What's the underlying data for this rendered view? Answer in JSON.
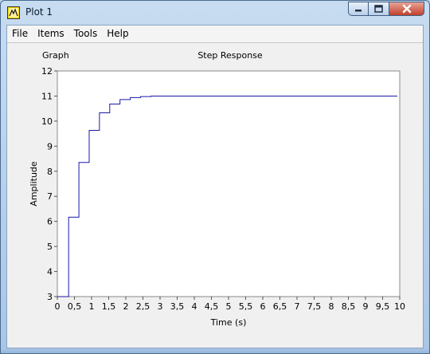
{
  "window": {
    "title": "Plot 1",
    "app_icon": "labview-icon",
    "controls": [
      "minimize-icon",
      "maximize-icon",
      "close-icon"
    ]
  },
  "menu": [
    "File",
    "Items",
    "Tools",
    "Help"
  ],
  "graph_label": "Graph",
  "chart_data": {
    "type": "line",
    "title": "Step Response",
    "xlabel": "Time (s)",
    "ylabel": "Amplitude",
    "xlim": [
      0,
      10
    ],
    "ylim": [
      3,
      12
    ],
    "x_ticks": [
      "0",
      "0,5",
      "1",
      "1,5",
      "2",
      "2,5",
      "3",
      "3,5",
      "4",
      "4,5",
      "5",
      "5,5",
      "6",
      "6,5",
      "7",
      "7,5",
      "8",
      "8,5",
      "9",
      "9,5",
      "10"
    ],
    "y_ticks": [
      "3",
      "4",
      "5",
      "6",
      "7",
      "8",
      "9",
      "10",
      "11",
      "12"
    ],
    "grid": false,
    "line_color": "#1a1aa8",
    "series": [
      {
        "step": true,
        "x": [
          0,
          0.33,
          0.63,
          0.93,
          1.23,
          1.53,
          1.83,
          2.13,
          2.43,
          2.73,
          9.93
        ],
        "y": [
          3.0,
          6.17,
          8.35,
          9.63,
          10.33,
          10.68,
          10.86,
          10.94,
          10.98,
          11.0,
          11.0
        ]
      }
    ]
  }
}
